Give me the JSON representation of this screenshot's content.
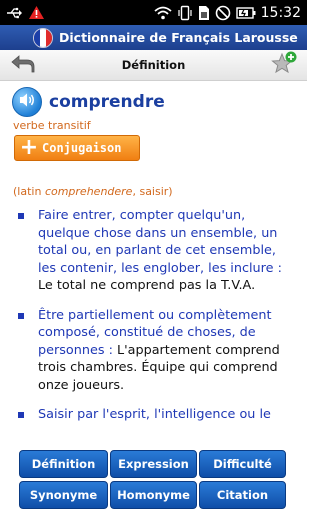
{
  "status_bar": {
    "time": "15:32",
    "icons": [
      "usb-icon",
      "warning-icon",
      "wifi-icon",
      "vibrate-icon",
      "sim-icon",
      "no-signal-icon",
      "battery-icon"
    ]
  },
  "app": {
    "title": "Dictionnaire de Français Larousse"
  },
  "toolbar": {
    "title": "Définition",
    "back_icon": "back-arrow-icon",
    "favorite_icon": "star-add-icon"
  },
  "entry": {
    "headword": "comprendre",
    "part_of_speech": "verbe transitif",
    "conjugation_button": "Conjugaison",
    "etymology_prefix": "(latin ",
    "etymology_word": "comprehendere",
    "etymology_suffix": ", saisir)",
    "definitions": [
      {
        "text": "Faire entrer, compter quelqu'un, quelque chose dans un ensemble, un total ou, en parlant de cet ensemble, les contenir, les englober, les inclure : ",
        "example": "Le total ne comprend pas la T.V.A."
      },
      {
        "text": "Être partiellement ou complètement composé, constitué de choses, de personnes : ",
        "example": "L'appartement comprend trois chambres. Équipe qui comprend onze joueurs."
      },
      {
        "text": "Saisir par l'esprit, l'intelligence ou le",
        "example": ""
      }
    ]
  },
  "bottom_buttons": {
    "definition": "Définition",
    "expression": "Expression",
    "difficulte": "Difficulté",
    "synonyme": "Synonyme",
    "homonyme": "Homonyme",
    "citation": "Citation"
  },
  "colors": {
    "title_bar": "#2f5db3",
    "headword": "#1b3fa0",
    "definition_text": "#1f38b5",
    "orange_label": "#d2691e",
    "conjugation_button": "#f07f12",
    "nav_button": "#1a63c3"
  }
}
